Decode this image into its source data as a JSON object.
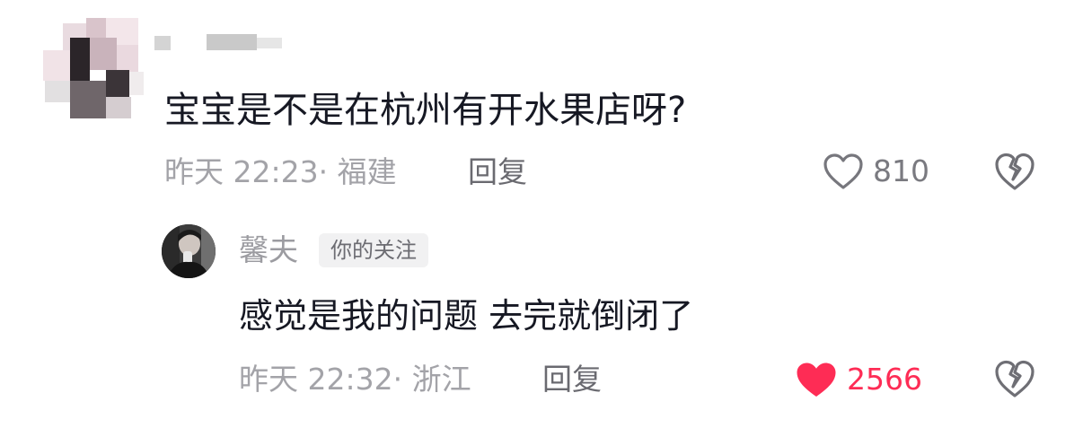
{
  "colors": {
    "text_primary": "#161823",
    "text_secondary": "#a3a3a8",
    "like_active": "#fe2c55"
  },
  "comment": {
    "text": "宝宝是不是在杭州有开水果店呀?",
    "time_location": "昨天 22:23· 福建",
    "reply_label": "回复",
    "like_count": "810",
    "liked": false
  },
  "reply": {
    "username": "馨夫",
    "badge": "你的关注",
    "text": "感觉是我的问题 去完就倒闭了",
    "time_location": "昨天 22:32· 浙江",
    "reply_label": "回复",
    "like_count": "2566",
    "liked": true
  },
  "icons": {
    "like": "heart-outline-icon",
    "liked": "heart-filled-icon",
    "dislike": "broken-heart-icon"
  }
}
